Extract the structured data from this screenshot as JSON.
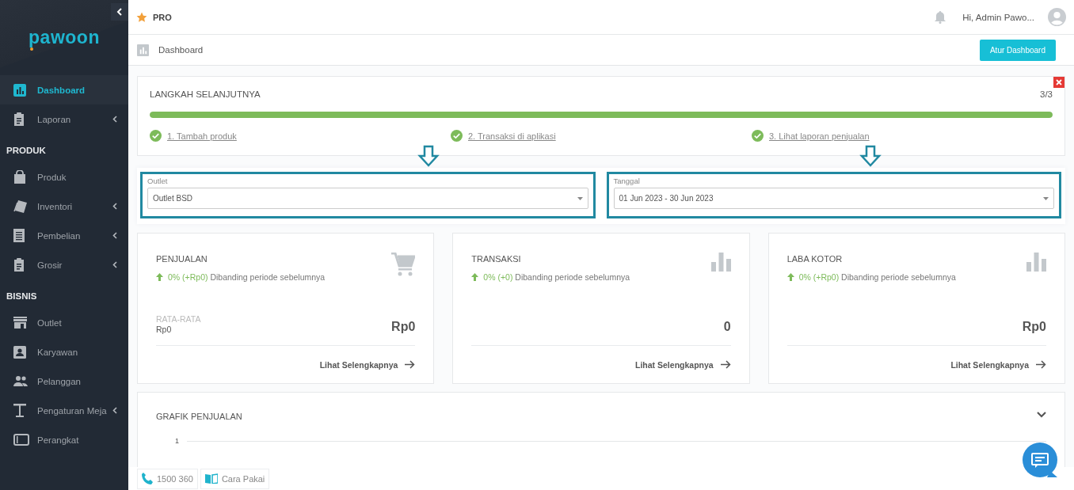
{
  "sidebar": {
    "logo": "pawoon",
    "sections": [
      {
        "items": [
          {
            "label": "Dashboard",
            "selected": true,
            "submenu": false
          },
          {
            "label": "Laporan",
            "selected": false,
            "submenu": true
          }
        ]
      },
      {
        "title": "PRODUK",
        "items": [
          {
            "label": "Produk",
            "selected": false,
            "submenu": false
          },
          {
            "label": "Inventori",
            "selected": false,
            "submenu": true
          },
          {
            "label": "Pembelian",
            "selected": false,
            "submenu": true
          },
          {
            "label": "Grosir",
            "selected": false,
            "submenu": true
          }
        ]
      },
      {
        "title": "BISNIS",
        "items": [
          {
            "label": "Outlet",
            "selected": false,
            "submenu": false
          },
          {
            "label": "Karyawan",
            "selected": false,
            "submenu": false
          },
          {
            "label": "Pelanggan",
            "selected": false,
            "submenu": false
          },
          {
            "label": "Pengaturan Meja",
            "selected": false,
            "submenu": true
          },
          {
            "label": "Perangkat",
            "selected": false,
            "submenu": false
          }
        ]
      }
    ]
  },
  "topbar": {
    "plan": "PRO",
    "greeting": "Hi, Admin Pawo..."
  },
  "header": {
    "title": "Dashboard",
    "button": "Atur Dashboard"
  },
  "next_steps": {
    "title": "LANGKAH SELANJUTNYA",
    "count": "3/3",
    "level": 1,
    "steps": [
      {
        "label": "1. Tambah produk",
        "done": true
      },
      {
        "label": "2. Transaksi di aplikasi",
        "done": true
      },
      {
        "label": "3. Lihat laporan penjualan",
        "done": true
      }
    ]
  },
  "filters": [
    {
      "label": "Outlet",
      "value": "Outlet BSD",
      "highlighted": true
    },
    {
      "label": "Tanggal",
      "value": "01 Jun 2023 - 30 Jun 2023",
      "highlighted": true
    }
  ],
  "stat_cards": [
    {
      "title": "PENJUALAN",
      "change": "0% (+Rp0)",
      "note": "Dibanding periode sebelumnya",
      "sub_label": "RATA-RATA",
      "sub_value": "Rp0",
      "value": "Rp0",
      "link": "Lihat Selengkapnya"
    },
    {
      "title": "TRANSAKSI",
      "change": "0% (+0)",
      "note": "Dibanding periode sebelumnya",
      "value": "0",
      "link": "Lihat Selengkapnya"
    },
    {
      "title": "LABA KOTOR",
      "change": "0% (+Rp0)",
      "note": "Dibanding periode sebelumnya",
      "value": "Rp0",
      "link": "Lihat Selengkapnya"
    }
  ],
  "chart_panel": {
    "title": "GRAFIK PENJUALAN",
    "y_tick": "1"
  },
  "footer": [
    {
      "label": "1500 360"
    },
    {
      "label": "Cara Pakai"
    }
  ]
}
